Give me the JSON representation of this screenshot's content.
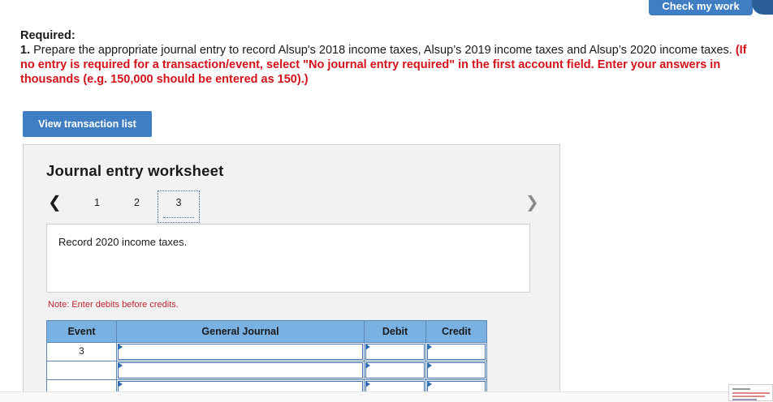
{
  "header": {
    "check_work_label": "Check my work"
  },
  "instructions": {
    "heading": "Required:",
    "number": "1.",
    "text": " Prepare the appropriate journal entry to record Alsup's 2018 income taxes, Alsup’s 2019 income taxes and Alsup’s 2020 income taxes. ",
    "red_text": "(If no entry is required for a transaction/event, select \"No journal entry required\" in the first account field. Enter your answers in thousands (e.g. 150,000 should be entered as 150).)"
  },
  "view_transaction_label": "View transaction list",
  "worksheet": {
    "title": "Journal entry worksheet",
    "pages": [
      "1",
      "2",
      "3"
    ],
    "active_page": "3",
    "description": "Record 2020 income taxes.",
    "note": "Note: Enter debits before credits.",
    "columns": {
      "event": "Event",
      "general_journal": "General Journal",
      "debit": "Debit",
      "credit": "Credit"
    },
    "rows": [
      {
        "event": "3",
        "account": "",
        "debit": "",
        "credit": ""
      },
      {
        "event": "",
        "account": "",
        "debit": "",
        "credit": ""
      },
      {
        "event": "",
        "account": "",
        "debit": "",
        "credit": ""
      }
    ]
  },
  "icons": {
    "prev": "chevron-left-icon",
    "next": "chevron-right-icon",
    "dropdown": "dropdown-triangle-icon"
  }
}
